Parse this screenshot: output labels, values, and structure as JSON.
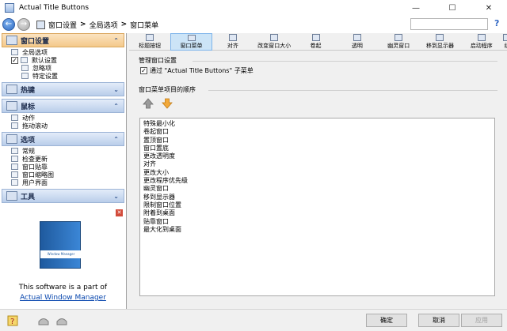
{
  "window": {
    "title": "Actual Title Buttons",
    "controls": [
      "minimize",
      "maximize",
      "close"
    ]
  },
  "nav": {
    "back_icon": "back-arrow-icon",
    "forward_icon": "forward-arrow-icon",
    "breadcrumb": [
      "窗口设置",
      "全局选项",
      "窗口菜单"
    ],
    "search_placeholder": "",
    "help_label": "?"
  },
  "sidebar": {
    "sections": [
      {
        "label": "窗口设置",
        "expanded": true,
        "items": [
          "全局选项",
          "默认设置",
          "忽略项",
          "特定设置"
        ]
      },
      {
        "label": "热键",
        "expanded": false,
        "items": []
      },
      {
        "label": "鼠标",
        "expanded": true,
        "items": [
          "动作",
          "拖动滚动"
        ]
      },
      {
        "label": "选项",
        "expanded": true,
        "items": [
          "常规",
          "检查更新",
          "窗口贴靠",
          "窗口缩略图",
          "用户界面"
        ]
      },
      {
        "label": "工具",
        "expanded": false,
        "items": []
      }
    ],
    "promo": {
      "line1": "This software is a part of",
      "link": "Actual Window Manager",
      "box_label": "Window Manager"
    }
  },
  "toolbar": {
    "items": [
      "标题按钮",
      "窗口菜单",
      "对齐",
      "改变窗口大小",
      "卷起",
      "透明",
      "幽灵窗口",
      "移到显示器",
      "启动程序",
      "组"
    ],
    "active_index": 1
  },
  "main": {
    "group1_title": "管理窗口设置",
    "checkbox_label": "通过 \"Actual Title Buttons\" 子菜单",
    "checkbox_checked": true,
    "group2_title": "窗口菜单项目的顺序",
    "order_list": [
      "特殊最小化",
      "卷起窗口",
      "置顶窗口",
      "窗口置底",
      "更改透明度",
      "对齐",
      "更改大小",
      "更改程序优先级",
      "幽灵窗口",
      "移到显示器",
      "限制窗口位置",
      "附着到桌面",
      "贴靠窗口",
      "最大化到桌面"
    ]
  },
  "footer": {
    "ok": "确定",
    "cancel": "取消",
    "apply": "应用"
  },
  "colors": {
    "accent": "#cce4f7",
    "section_active": "#f4c98a",
    "section": "#b9cdea"
  }
}
